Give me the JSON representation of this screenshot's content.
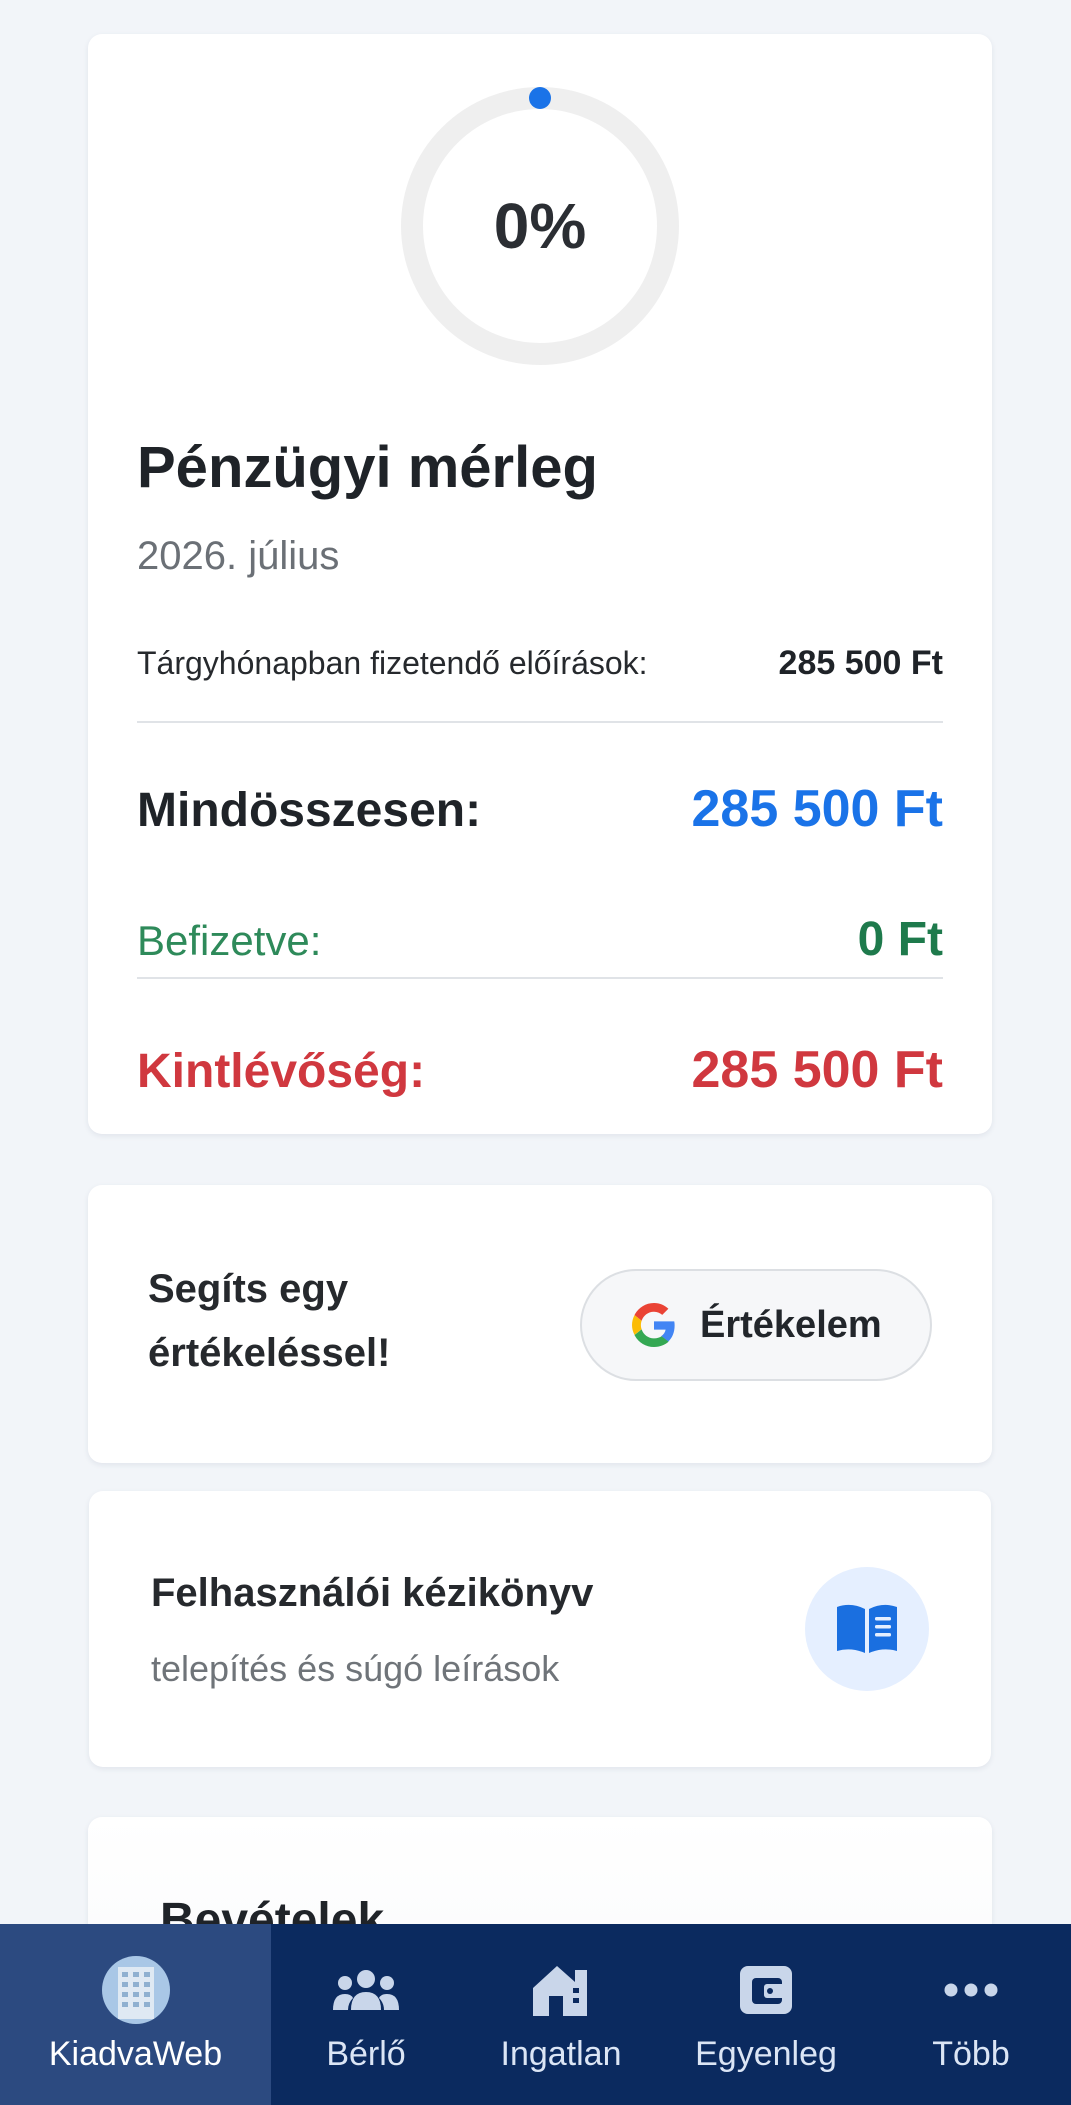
{
  "balance": {
    "progress_percent": 0,
    "progress_label": "0%",
    "title": "Pénzügyi mérleg",
    "period": "2026. július",
    "due_label": "Tárgyhónapban fizetendő előírások:",
    "due_value": "285 500 Ft",
    "total_label": "Mindösszesen:",
    "total_value": "285 500 Ft",
    "paid_label": "Befizetve:",
    "paid_value": "0 Ft",
    "outstanding_label": "Kintlévőség:",
    "outstanding_value": "285 500 Ft",
    "colors": {
      "accent": "#1a73e8",
      "paid": "#1e7a4c",
      "outstanding": "#d0383f"
    }
  },
  "review": {
    "text": "Segíts egy értékeléssel!",
    "button_label": "Értékelem",
    "icon": "google-g-icon"
  },
  "manual": {
    "title": "Felhasználói kézikönyv",
    "subtitle": "telepítés és súgó leírások",
    "icon": "book-icon"
  },
  "revenue": {
    "title": "Bevételek"
  },
  "nav": {
    "items": [
      {
        "label": "KiadvaWeb",
        "icon": "building-avatar-icon",
        "active": true
      },
      {
        "label": "Bérlő",
        "icon": "users-icon",
        "active": false
      },
      {
        "label": "Ingatlan",
        "icon": "house-icon",
        "active": false
      },
      {
        "label": "Egyenleg",
        "icon": "wallet-icon",
        "active": false
      },
      {
        "label": "Több",
        "icon": "more-dots-icon",
        "active": false
      }
    ],
    "colors": {
      "background": "#0b2a5f",
      "active": "#2c4a80"
    }
  }
}
